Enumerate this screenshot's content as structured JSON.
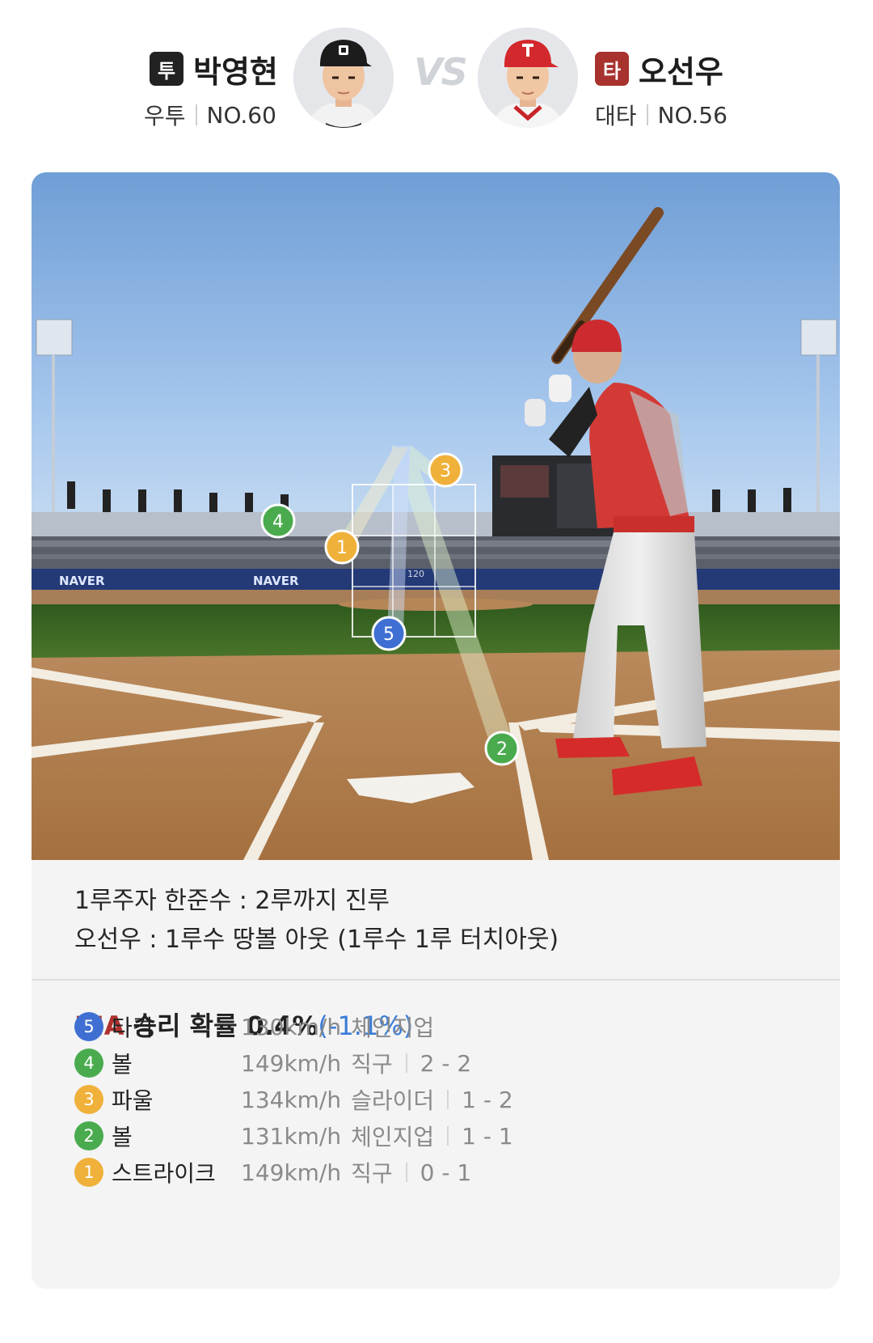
{
  "header": {
    "pitcher": {
      "badge": "투",
      "name": "박영현",
      "position": "우투",
      "number": "NO.60",
      "badge_color": "#222222"
    },
    "vs": "VS",
    "batter": {
      "badge": "타",
      "name": "오선우",
      "position": "대타",
      "number": "NO.56",
      "badge_color": "#a8322e"
    }
  },
  "field": {
    "markers": [
      {
        "num": "1",
        "color": "#f0b13a"
      },
      {
        "num": "2",
        "color": "#4aab4e"
      },
      {
        "num": "3",
        "color": "#f0b13a"
      },
      {
        "num": "4",
        "color": "#4aab4e"
      },
      {
        "num": "5",
        "color": "#3f6fd2"
      }
    ],
    "ads": [
      "NAVER",
      "NAVER"
    ],
    "strike_zone_value": "120"
  },
  "events": [
    "1루주자 한준수 : 2루까지 진루",
    "오선우 : 1루수 땅볼 아웃 (1루수 1루 터치아웃)"
  ],
  "win_probability": {
    "team": "KIA",
    "label": "승리 확률",
    "value": "0.4%",
    "delta": "(-1.1%)",
    "team_color": "#b0312e",
    "delta_color": "#3b7dd8"
  },
  "pitches": [
    {
      "num": "5",
      "color": "#3f6fd2",
      "result": "타격",
      "speed": "130km/h",
      "type": "체인지업",
      "count": ""
    },
    {
      "num": "4",
      "color": "#4aab4e",
      "result": "볼",
      "speed": "149km/h",
      "type": "직구",
      "count": "2 - 2"
    },
    {
      "num": "3",
      "color": "#f0b13a",
      "result": "파울",
      "speed": "134km/h",
      "type": "슬라이더",
      "count": "1 - 2"
    },
    {
      "num": "2",
      "color": "#4aab4e",
      "result": "볼",
      "speed": "131km/h",
      "type": "체인지업",
      "count": "1 - 1"
    },
    {
      "num": "1",
      "color": "#f0b13a",
      "result": "스트라이크",
      "speed": "149km/h",
      "type": "직구",
      "count": "0 - 1"
    }
  ]
}
